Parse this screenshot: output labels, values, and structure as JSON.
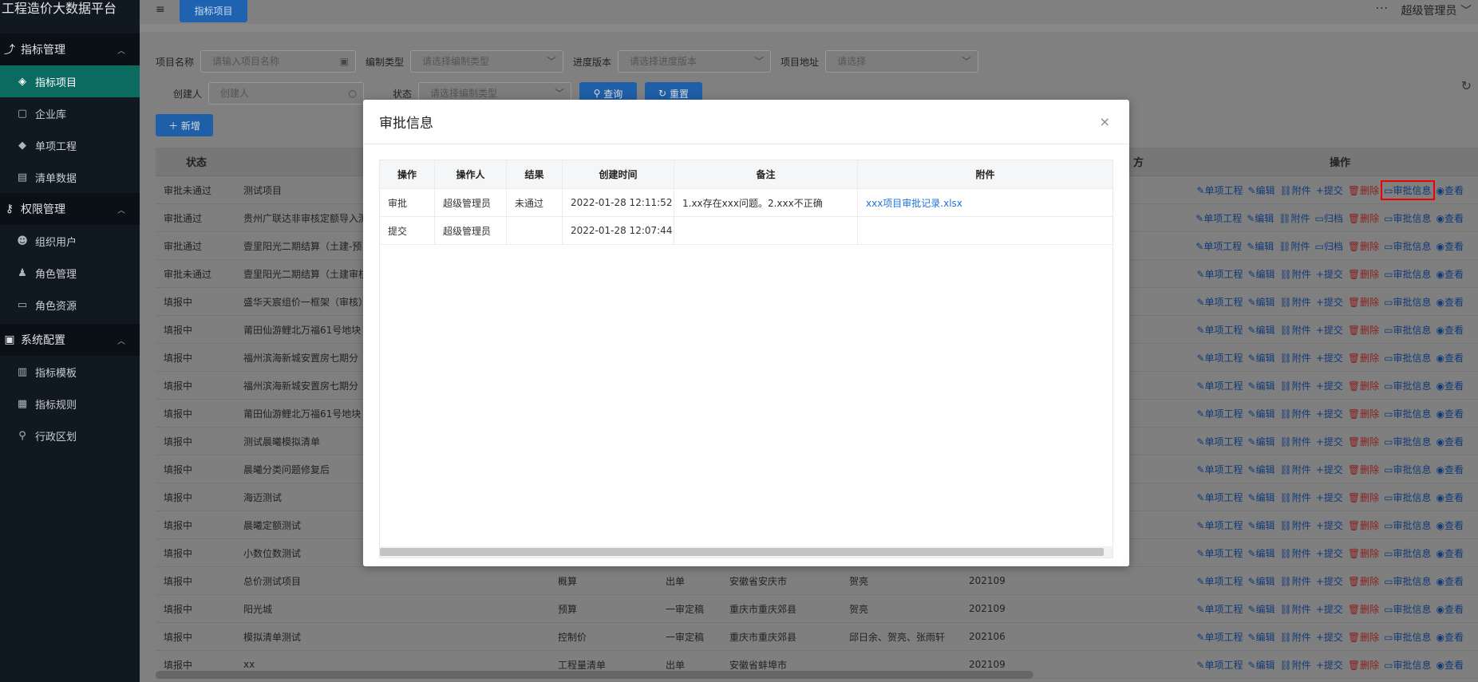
{
  "app": {
    "brand": "工程造价大数据平台"
  },
  "sidebar": {
    "groups": [
      {
        "label": "指标管理",
        "icon": "chart-icon",
        "items": [
          {
            "label": "指标项目",
            "icon": "layers-icon",
            "active": true
          },
          {
            "label": "企业库",
            "icon": "box-icon"
          },
          {
            "label": "单项工程",
            "icon": "stack-icon"
          },
          {
            "label": "清单数据",
            "icon": "clipboard-icon"
          }
        ]
      },
      {
        "label": "权限管理",
        "icon": "key-icon",
        "items": [
          {
            "label": "组织用户",
            "icon": "users-icon"
          },
          {
            "label": "角色管理",
            "icon": "user-icon"
          },
          {
            "label": "角色资源",
            "icon": "resource-icon"
          }
        ]
      },
      {
        "label": "系统配置",
        "icon": "config-icon",
        "items": [
          {
            "label": "指标模板",
            "icon": "template-icon"
          },
          {
            "label": "指标规则",
            "icon": "rules-icon"
          },
          {
            "label": "行政区划",
            "icon": "region-icon"
          }
        ]
      }
    ]
  },
  "topbar": {
    "tab": "指标项目",
    "dots": "···",
    "user": "超级管理员"
  },
  "filters": {
    "project_name_label": "项目名称",
    "project_name_placeholder": "请输入项目名称",
    "compile_type_label": "编制类型",
    "compile_type_placeholder": "请选择编制类型",
    "progress_label": "进度版本",
    "progress_placeholder": "请选择进度版本",
    "address_label": "项目地址",
    "address_placeholder": "请选择",
    "creator_label": "创建人",
    "creator_placeholder": "创建人",
    "status_label": "状态",
    "status_placeholder": "请选择编制类型",
    "query_label": "查询",
    "reset_label": "重置",
    "add_label": "新增"
  },
  "table": {
    "headers": {
      "status": "状态",
      "ops": "操作",
      "partial": "方"
    },
    "rows": [
      {
        "status": "审批未通过",
        "name": "测试项目",
        "type": "",
        "prog": "",
        "addr": "",
        "person": "",
        "ver": "",
        "ops": [
          "单项工程",
          "编辑",
          "附件",
          "提交",
          "删除",
          "审批信息",
          "查看"
        ]
      },
      {
        "status": "审批通过",
        "name": "贵州广联达非审核定额导入测",
        "type": "",
        "prog": "",
        "addr": "",
        "person": "",
        "ver": "",
        "ops": [
          "单项工程",
          "编辑",
          "附件",
          "归档",
          "删除",
          "审批信息",
          "查看"
        ]
      },
      {
        "status": "审批通过",
        "name": "壹里阳光二期结算（土建-预",
        "type": "",
        "prog": "",
        "addr": "",
        "person": "",
        "ver": "",
        "ops": [
          "单项工程",
          "编辑",
          "附件",
          "归档",
          "删除",
          "审批信息",
          "查看"
        ]
      },
      {
        "status": "审批未通过",
        "name": "壹里阳光二期结算（土建审核",
        "type": "",
        "prog": "",
        "addr": "",
        "person": "",
        "ver": "",
        "ops": [
          "单项工程",
          "编辑",
          "附件",
          "提交",
          "删除",
          "审批信息",
          "查看"
        ]
      },
      {
        "status": "填报中",
        "name": "盛华天宸组价一框架（审核）",
        "type": "",
        "prog": "",
        "addr": "",
        "person": "",
        "ver": "",
        "ops": [
          "单项工程",
          "编辑",
          "附件",
          "提交",
          "删除",
          "审批信息",
          "查看"
        ]
      },
      {
        "status": "填报中",
        "name": "莆田仙游鲤北万福61号地块",
        "type": "",
        "prog": "",
        "addr": "",
        "person": "",
        "ver": "",
        "ops": [
          "单项工程",
          "编辑",
          "附件",
          "提交",
          "删除",
          "审批信息",
          "查看"
        ]
      },
      {
        "status": "填报中",
        "name": "福州滨海新城安置房七期分",
        "type": "",
        "prog": "",
        "addr": "",
        "person": "",
        "ver": "",
        "ops": [
          "单项工程",
          "编辑",
          "附件",
          "提交",
          "删除",
          "审批信息",
          "查看"
        ]
      },
      {
        "status": "填报中",
        "name": "福州滨海新城安置房七期分",
        "type": "",
        "prog": "",
        "addr": "",
        "person": "",
        "ver": "",
        "ops": [
          "单项工程",
          "编辑",
          "附件",
          "提交",
          "删除",
          "审批信息",
          "查看"
        ]
      },
      {
        "status": "填报中",
        "name": "莆田仙游鲤北万福61号地块",
        "type": "",
        "prog": "",
        "addr": "",
        "person": "",
        "ver": "",
        "ops": [
          "单项工程",
          "编辑",
          "附件",
          "提交",
          "删除",
          "审批信息",
          "查看"
        ]
      },
      {
        "status": "填报中",
        "name": "测试晨曦模拟清单",
        "type": "",
        "prog": "",
        "addr": "",
        "person": "",
        "ver": "",
        "ops": [
          "单项工程",
          "编辑",
          "附件",
          "提交",
          "删除",
          "审批信息",
          "查看"
        ]
      },
      {
        "status": "填报中",
        "name": "晨曦分类问题修复后",
        "type": "",
        "prog": "",
        "addr": "",
        "person": "",
        "ver": "",
        "ops": [
          "单项工程",
          "编辑",
          "附件",
          "提交",
          "删除",
          "审批信息",
          "查看"
        ]
      },
      {
        "status": "填报中",
        "name": "海迈测试",
        "type": "",
        "prog": "",
        "addr": "",
        "person": "",
        "ver": "",
        "ops": [
          "单项工程",
          "编辑",
          "附件",
          "提交",
          "删除",
          "审批信息",
          "查看"
        ]
      },
      {
        "status": "填报中",
        "name": "晨曦定额测试",
        "type": "",
        "prog": "",
        "addr": "",
        "person": "",
        "ver": "",
        "ops": [
          "单项工程",
          "编辑",
          "附件",
          "提交",
          "删除",
          "审批信息",
          "查看"
        ]
      },
      {
        "status": "填报中",
        "name": "小数位数测试",
        "type": "",
        "prog": "",
        "addr": "",
        "person": "",
        "ver": "",
        "ops": [
          "单项工程",
          "编辑",
          "附件",
          "提交",
          "删除",
          "审批信息",
          "查看"
        ]
      },
      {
        "status": "填报中",
        "name": "总价测试项目",
        "type": "概算",
        "prog": "出单",
        "addr": "安徽省安庆市",
        "person": "贺亮",
        "ver": "202109",
        "ops": [
          "单项工程",
          "编辑",
          "附件",
          "提交",
          "删除",
          "审批信息",
          "查看"
        ]
      },
      {
        "status": "填报中",
        "name": "阳光城",
        "type": "预算",
        "prog": "一审定稿",
        "addr": "重庆市重庆郊县",
        "person": "贺亮",
        "ver": "202109",
        "ops": [
          "单项工程",
          "编辑",
          "附件",
          "提交",
          "删除",
          "审批信息",
          "查看"
        ]
      },
      {
        "status": "填报中",
        "name": "模拟清单测试",
        "type": "控制价",
        "prog": "一审定稿",
        "addr": "重庆市重庆郊县",
        "person": "邱日余、贺亮、张雨轩",
        "ver": "202106",
        "ops": [
          "单项工程",
          "编辑",
          "附件",
          "提交",
          "删除",
          "审批信息",
          "查看"
        ]
      },
      {
        "status": "填报中",
        "name": "xx",
        "type": "工程量清单",
        "prog": "出单",
        "addr": "安徽省蚌埠市",
        "person": "",
        "ver": "202109",
        "ops": [
          "单项工程",
          "编辑",
          "附件",
          "提交",
          "删除",
          "审批信息",
          "查看"
        ]
      }
    ]
  },
  "modal": {
    "title": "审批信息",
    "close": "×",
    "headers": [
      "操作",
      "操作人",
      "结果",
      "创建时间",
      "备注",
      "附件"
    ],
    "rows": [
      [
        "审批",
        "超级管理员",
        "未通过",
        "2022-01-28 12:11:52",
        "1.xx存在xxx问题。2.xxx不正确",
        "xxx项目审批记录.xlsx"
      ],
      [
        "提交",
        "超级管理员",
        "",
        "2022-01-28 12:07:44",
        "",
        ""
      ]
    ]
  }
}
